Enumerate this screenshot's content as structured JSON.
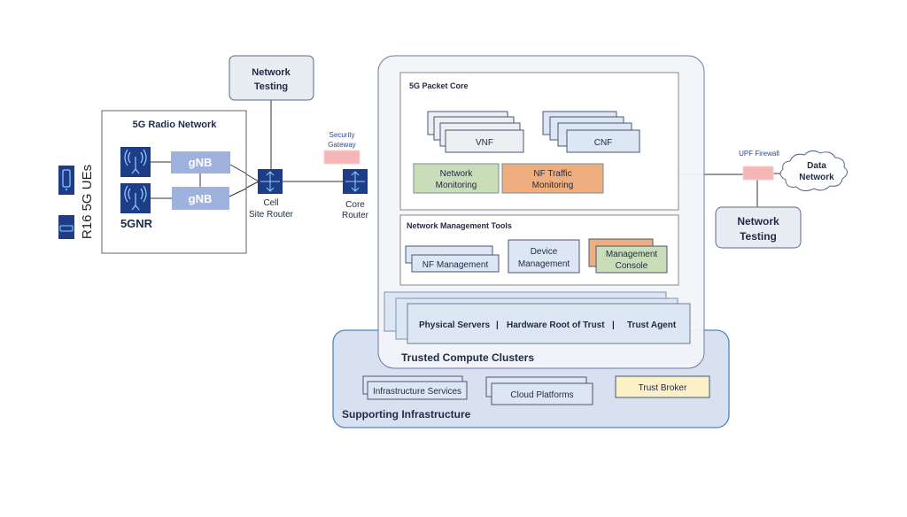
{
  "ue": {
    "label": "R16 5G UEs",
    "icons": [
      "phone-icon",
      "cpe-router-icon"
    ]
  },
  "radio": {
    "title": "5G Radio Network",
    "gnb1": "gNB",
    "gnb2": "gNB",
    "nr_label": "5GNR"
  },
  "network_testing_top": {
    "line1": "Network",
    "line2": "Testing"
  },
  "cell_router": {
    "line1": "Cell",
    "line2": "Site Router"
  },
  "security_gateway": {
    "line1": "Security",
    "line2": "Gateway"
  },
  "core_router": {
    "line1": "Core",
    "line2": "Router"
  },
  "packet_core": {
    "title": "5G Packet Core",
    "vnf": "VNF",
    "cnf": "CNF",
    "network_monitoring": [
      "Network",
      "Monitoring"
    ],
    "nf_traffic_monitoring": [
      "NF Traffic",
      "Monitoring"
    ]
  },
  "mgmt_tools": {
    "title": "Network Management Tools",
    "nf_management": "NF Management",
    "device_management": [
      "Device",
      "Management"
    ],
    "management_console": [
      "Management",
      "Console"
    ]
  },
  "servers": {
    "physical": "Physical Servers",
    "sep1": "|",
    "hrot": "Hardware Root of Trust",
    "sep2": "|",
    "agent": "Trust Agent"
  },
  "trusted_clusters": {
    "title": "Trusted Compute Clusters"
  },
  "supporting": {
    "title": "Supporting Infrastructure",
    "infra_services": "Infrastructure Services",
    "cloud_platforms": "Cloud Platforms",
    "trust_broker": "Trust Broker"
  },
  "upf_firewall": {
    "label": "UPF Firewall"
  },
  "data_network": {
    "line1": "Data",
    "line2": "Network"
  },
  "network_testing_right": {
    "line1": "Network",
    "line2": "Testing"
  },
  "colors": {
    "icon_blue": "#1f3c88",
    "gnb": "#9fb1dd",
    "green": "#c9deb8",
    "orange": "#efae80",
    "light_blue": "#dde7f4",
    "gray": "#eceef2",
    "supporting_fill": "#d9e1f1",
    "supporting_border": "#4a86c0",
    "firewall": "#f4b6b6",
    "trust_broker": "#fbf0c8"
  }
}
